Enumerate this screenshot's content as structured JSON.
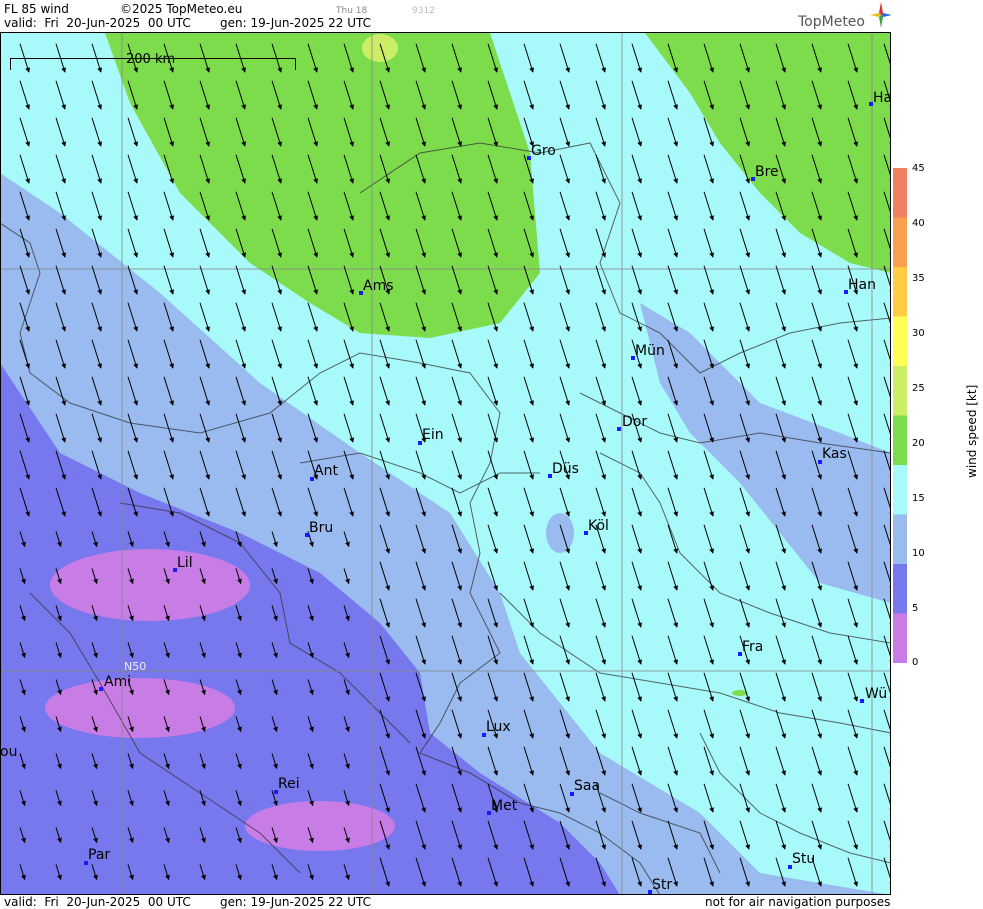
{
  "header": {
    "product": "FL 85 wind",
    "copyright": "©2025 TopMeteo.eu",
    "run_day": "Thu 18",
    "code": "9312",
    "valid": "valid:  Fri  20-Jun-2025  00 UTC",
    "generated": "gen: 19-Jun-2025 22 UTC"
  },
  "footer": {
    "valid": "valid:  Fri  20-Jun-2025  00 UTC",
    "generated": "gen: 19-Jun-2025 22 UTC",
    "disclaimer": "not for air navigation purposes"
  },
  "logo": {
    "text": "TopMeteo"
  },
  "scale_bar": {
    "label": "200 km"
  },
  "grid_label": {
    "lat": "N50"
  },
  "legend": {
    "title": "wind  speed  [kt]",
    "ticks": [
      "45",
      "40",
      "35",
      "30",
      "25",
      "20",
      "15",
      "10",
      "5",
      "0"
    ],
    "colors": [
      "#f08060",
      "#f8a050",
      "#ffcc44",
      "#ffff55",
      "#ccee66",
      "#7cdc4c",
      "#a8fafa",
      "#99bbf0",
      "#7777ee",
      "#c77ce6"
    ]
  },
  "cities": [
    {
      "name": "Gro"
    },
    {
      "name": "Bre"
    },
    {
      "name": "Ha"
    },
    {
      "name": "Ams"
    },
    {
      "name": "Han"
    },
    {
      "name": "Mün"
    },
    {
      "name": "Dor"
    },
    {
      "name": "Ein"
    },
    {
      "name": "Kas"
    },
    {
      "name": "Düs"
    },
    {
      "name": "Ant"
    },
    {
      "name": "Köl"
    },
    {
      "name": "Bru"
    },
    {
      "name": "Lil"
    },
    {
      "name": "Fra"
    },
    {
      "name": "Wü"
    },
    {
      "name": "Ami"
    },
    {
      "name": "ou"
    },
    {
      "name": "Lux"
    },
    {
      "name": "Saa"
    },
    {
      "name": "Rei"
    },
    {
      "name": "Met"
    },
    {
      "name": "Stu"
    },
    {
      "name": "Par"
    },
    {
      "name": "Str"
    }
  ]
}
